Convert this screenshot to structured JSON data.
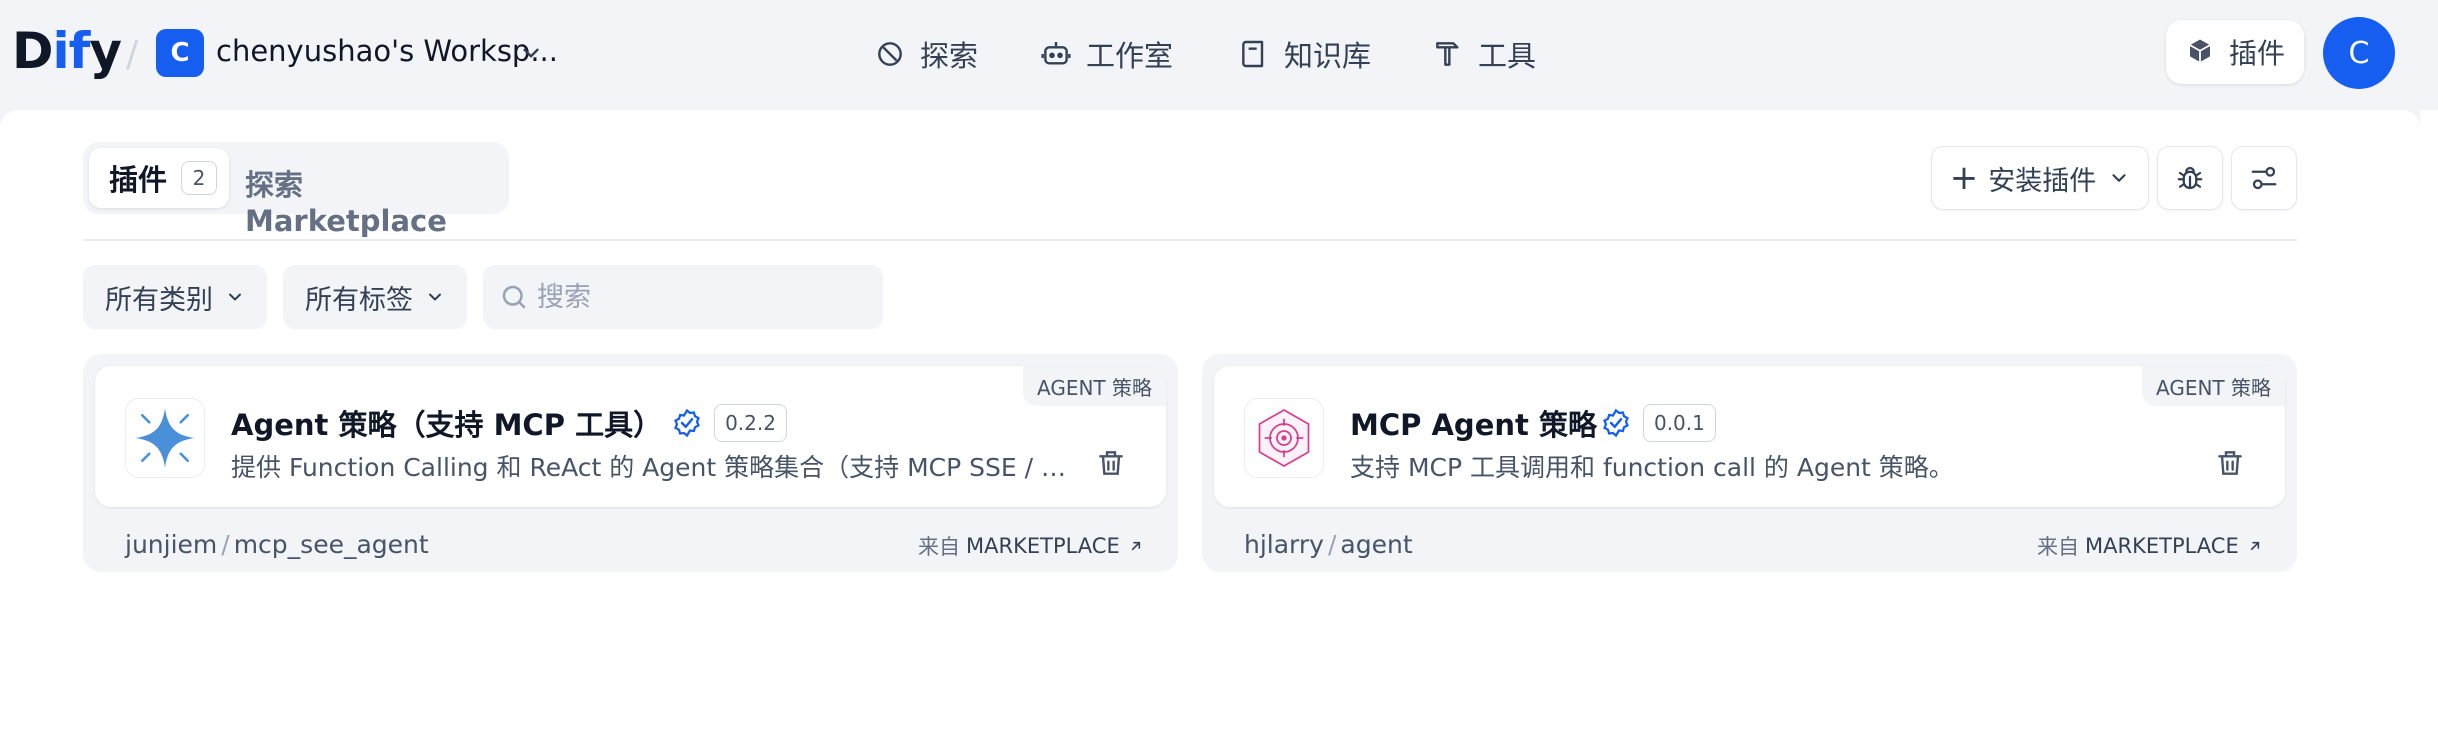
{
  "header": {
    "logo_prefix": "D",
    "logo_blue": "if",
    "logo_suffix": "y",
    "workspace_initial": "C",
    "workspace_name": "chenyushao's Worksp...",
    "nav": [
      {
        "label": "探索",
        "icon": "compass-icon"
      },
      {
        "label": "工作室",
        "icon": "robot-icon"
      },
      {
        "label": "知识库",
        "icon": "book-icon"
      },
      {
        "label": "工具",
        "icon": "hammer-icon"
      }
    ],
    "plugin_label": "插件",
    "avatar_initial": "C"
  },
  "tabs": {
    "active_label": "插件",
    "active_count": "2",
    "marketplace_label": "探索 Marketplace"
  },
  "actions": {
    "install_label": "安装插件"
  },
  "filters": {
    "category_label": "所有类别",
    "tags_label": "所有标签",
    "search_placeholder": "搜索"
  },
  "plugins": [
    {
      "title": "Agent 策略（支持 MCP 工具）",
      "version": "0.2.2",
      "description": "提供 Function Calling 和 ReAct 的 Agent 策略集合（支持 MCP SSE / Strea...",
      "type": "AGENT 策略",
      "author": "junjiem",
      "repo": "mcp_see_agent",
      "source_prefix": "来自",
      "source": "MARKETPLACE"
    },
    {
      "title": "MCP Agent 策略",
      "version": "0.0.1",
      "description": "支持 MCP 工具调用和 function call 的 Agent 策略。",
      "type": "AGENT 策略",
      "author": "hjlarry",
      "repo": "agent",
      "source_prefix": "来自",
      "source": "MARKETPLACE"
    }
  ],
  "colors": {
    "accent": "#155eef",
    "page_bg": "#f2f4f7"
  }
}
